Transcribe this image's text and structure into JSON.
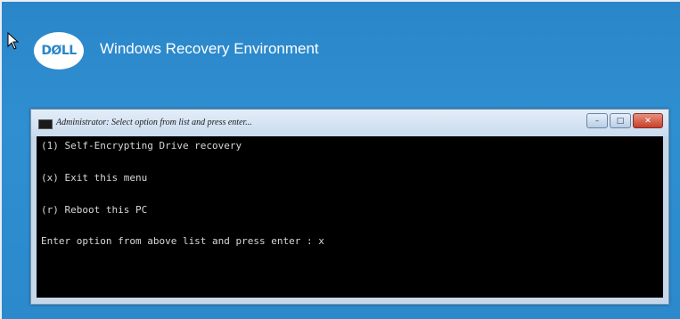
{
  "header": {
    "logo_text": "DØLL",
    "title": "Windows Recovery Environment"
  },
  "window": {
    "title": "Administrator: Select option from list and press enter...",
    "controls": {
      "minimize": "–",
      "maximize": "□",
      "close": "✕"
    }
  },
  "console": {
    "lines": [
      "(1) Self-Encrypting Drive recovery",
      "(x) Exit this menu",
      "(r) Reboot this PC",
      "Enter option from above list and press enter : x"
    ]
  },
  "colors": {
    "desktop": "#2a86c9",
    "console_bg": "#000000",
    "console_text": "#d8d8d8",
    "close_button": "#c6402b"
  },
  "icons": [
    "mouse-cursor-icon",
    "console-window-icon"
  ]
}
